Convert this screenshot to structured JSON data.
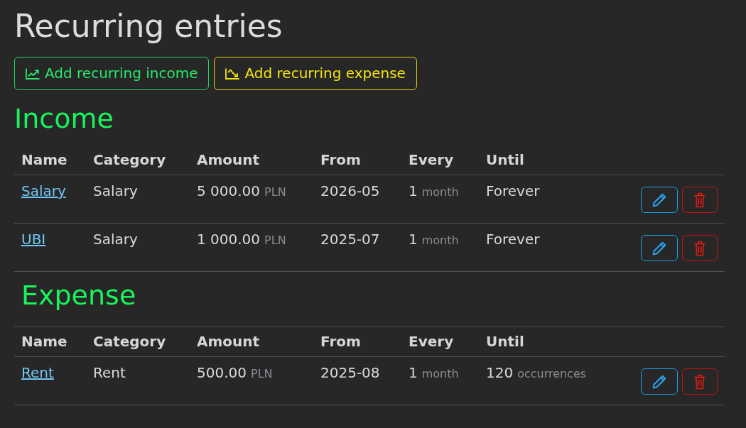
{
  "title": "Recurring entries",
  "actions": [
    {
      "kind": "income",
      "label": "Add recurring income"
    },
    {
      "kind": "expense",
      "label": "Add recurring expense"
    }
  ],
  "sections": [
    {
      "heading": "Income",
      "columns": [
        "Name",
        "Category",
        "Amount",
        "From",
        "Every",
        "Until"
      ],
      "rows": [
        {
          "name": "Salary",
          "category": "Salary",
          "amount": "5 000.00",
          "currency": "PLN",
          "from": "2026-05",
          "every": "1",
          "every_unit": "month",
          "until": "Forever"
        },
        {
          "name": "UBI",
          "category": "Salary",
          "amount": "1 000.00",
          "currency": "PLN",
          "from": "2025-07",
          "every": "1",
          "every_unit": "month",
          "until": "Forever"
        }
      ]
    },
    {
      "heading": "Expense",
      "columns": [
        "Name",
        "Category",
        "Amount",
        "From",
        "Every",
        "Until"
      ],
      "rows": [
        {
          "name": "Rent",
          "category": "Rent",
          "amount": "500.00",
          "currency": "PLN",
          "from": "2025-08",
          "every": "1",
          "every_unit": "month",
          "until": "120",
          "until_unit": "occurrences"
        }
      ]
    }
  ]
}
